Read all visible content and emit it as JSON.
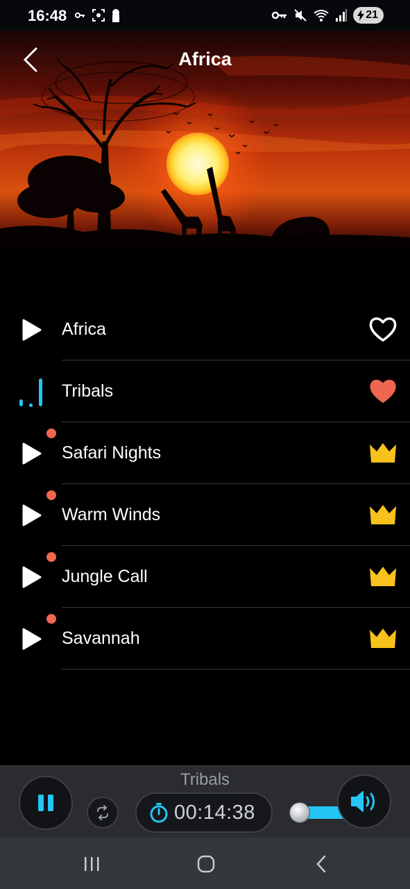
{
  "status": {
    "time": "16:48",
    "battery_level": "21",
    "left_icons": [
      "key-icon",
      "screenshot-icon",
      "keyhole-icon"
    ],
    "right_icons": [
      "vpn-key-icon",
      "mute-icon",
      "wifi-icon",
      "signal-icon"
    ]
  },
  "header": {
    "title": "Africa",
    "back_icon": "chevron-left-icon"
  },
  "tracks": [
    {
      "name": "Africa",
      "state": "play",
      "badge": "heart-outline",
      "new": false
    },
    {
      "name": "Tribals",
      "state": "playing",
      "badge": "heart-filled",
      "new": false
    },
    {
      "name": "Safari Nights",
      "state": "play",
      "badge": "crown",
      "new": true
    },
    {
      "name": "Warm Winds",
      "state": "play",
      "badge": "crown",
      "new": true
    },
    {
      "name": "Jungle Call",
      "state": "play",
      "badge": "crown",
      "new": true
    },
    {
      "name": "Savannah",
      "state": "play",
      "badge": "crown",
      "new": true
    }
  ],
  "player": {
    "now_playing": "Tribals",
    "timer": "00:14:38",
    "volume_level": 0.85
  },
  "colors": {
    "accent": "#24c6f5",
    "heart": "#f0664f",
    "crown": "#f7c21c",
    "new_dot": "#f0664f"
  }
}
